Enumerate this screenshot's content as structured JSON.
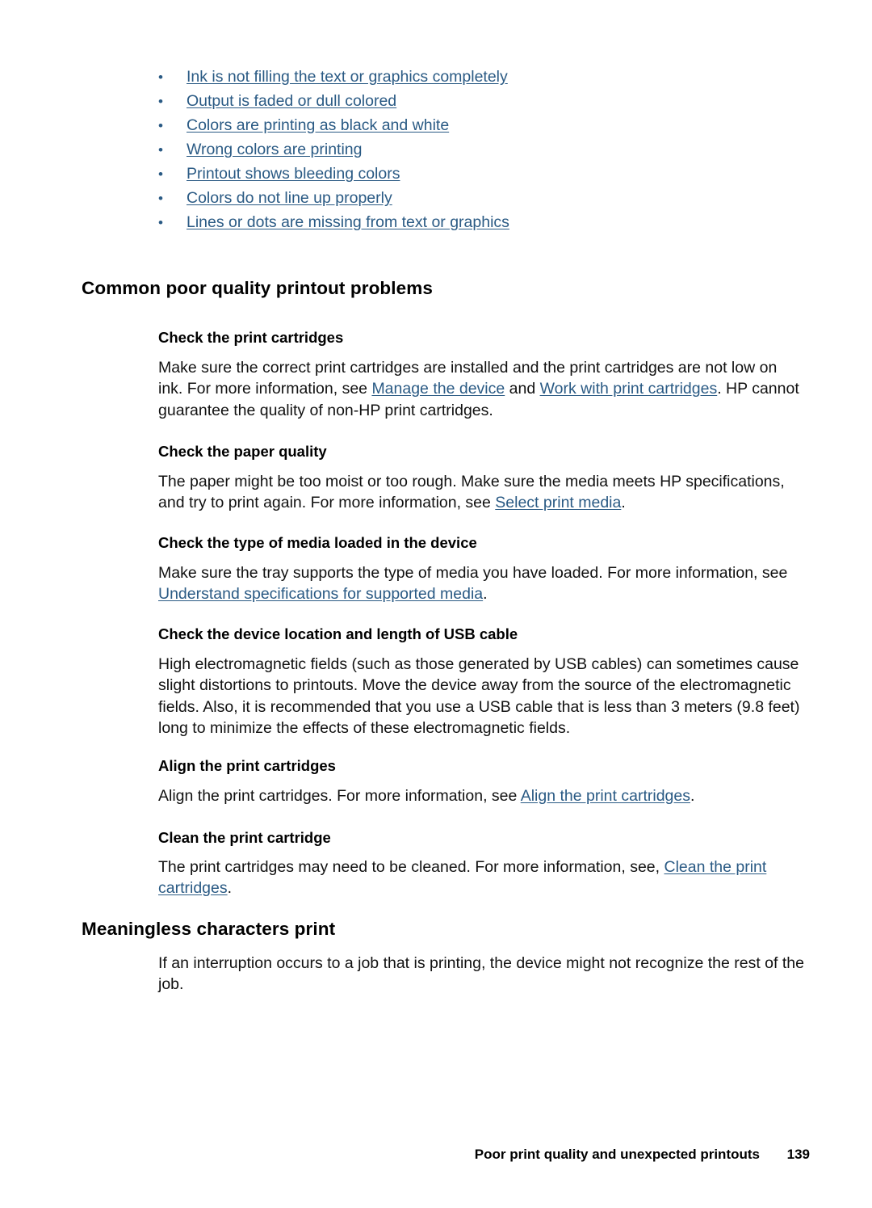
{
  "topic_links": [
    {
      "label": "Ink is not filling the text or graphics completely"
    },
    {
      "label": "Output is faded or dull colored"
    },
    {
      "label": "Colors are printing as black and white"
    },
    {
      "label": "Wrong colors are printing"
    },
    {
      "label": "Printout shows bleeding colors"
    },
    {
      "label": "Colors do not line up properly"
    },
    {
      "label": "Lines or dots are missing from text or graphics"
    }
  ],
  "sections": {
    "common_problems": {
      "heading": "Common poor quality printout problems",
      "check_cartridges": {
        "heading": "Check the print cartridges",
        "text_1": "Make sure the correct print cartridges are installed and the print cartridges are not low on ink. For more information, see ",
        "link_1": "Manage the device",
        "text_2": " and ",
        "link_2": "Work with print cartridges",
        "text_3": ". HP cannot guarantee the quality of non-HP print cartridges."
      },
      "paper_quality": {
        "heading": "Check the paper quality",
        "text_1": "The paper might be too moist or too rough. Make sure the media meets HP specifications, and try to print again. For more information, see ",
        "link_1": "Select print media",
        "text_2": "."
      },
      "media_type": {
        "heading": "Check the type of media loaded in the device",
        "text_1": "Make sure the tray supports the type of media you have loaded. For more information, see ",
        "link_1": "Understand specifications for supported media",
        "text_2": "."
      },
      "usb_cable": {
        "heading": "Check the device location and length of USB cable",
        "text_1": "High electromagnetic fields (such as those generated by USB cables) can sometimes cause slight distortions to printouts. Move the device away from the source of the electromagnetic fields. Also, it is recommended that you use a USB cable that is less than 3 meters (9.8 feet) long to minimize the effects of these electromagnetic fields."
      },
      "align_cartridges": {
        "heading": "Align the print cartridges",
        "text_1": "Align the print cartridges. For more information, see ",
        "link_1": "Align the print cartridges",
        "text_2": "."
      },
      "clean_cartridge": {
        "heading": "Clean the print cartridge",
        "text_1": "The print cartridges may need to be cleaned. For more information, see, ",
        "link_1": "Clean the print cartridges",
        "text_2": "."
      }
    },
    "meaningless_characters": {
      "heading": "Meaningless characters print",
      "text_1": "If an interruption occurs to a job that is printing, the device might not recognize the rest of the job."
    }
  },
  "footer": {
    "text": "Poor print quality and unexpected printouts",
    "page_number": "139"
  },
  "colors": {
    "link": "#2a5a84",
    "body_text": "#111111",
    "background": "#ffffff"
  },
  "icons": {
    "bullet": "bullet-icon",
    "bullet_glyph": "•"
  }
}
